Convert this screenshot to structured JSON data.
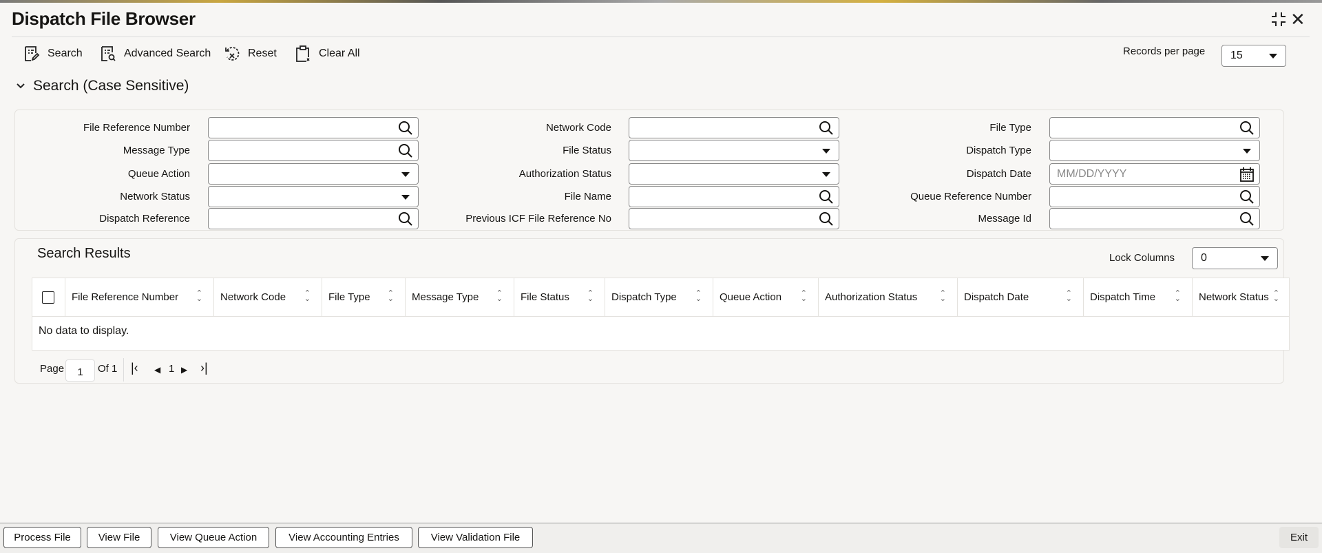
{
  "header": {
    "title": "Dispatch File Browser"
  },
  "toolbar": {
    "search": "Search",
    "advanced_search": "Advanced Search",
    "reset": "Reset",
    "clear_all": "Clear All"
  },
  "records_per_page": {
    "label": "Records per page",
    "value": "15"
  },
  "search_section": {
    "title": "Search (Case Sensitive)",
    "fields": [
      {
        "label": "File Reference Number",
        "type": "search",
        "value": ""
      },
      {
        "label": "Network Code",
        "type": "search",
        "value": ""
      },
      {
        "label": "File Type",
        "type": "search",
        "value": ""
      },
      {
        "label": "Message Type",
        "type": "search",
        "value": ""
      },
      {
        "label": "File Status",
        "type": "select",
        "value": ""
      },
      {
        "label": "Dispatch Type",
        "type": "select",
        "value": ""
      },
      {
        "label": "Queue Action",
        "type": "select",
        "value": ""
      },
      {
        "label": "Authorization Status",
        "type": "select",
        "value": ""
      },
      {
        "label": "Dispatch Date",
        "type": "date",
        "value": "",
        "placeholder": "MM/DD/YYYY"
      },
      {
        "label": "Network Status",
        "type": "select",
        "value": ""
      },
      {
        "label": "File Name",
        "type": "search",
        "value": ""
      },
      {
        "label": "Queue Reference Number",
        "type": "search",
        "value": ""
      },
      {
        "label": "Dispatch Reference",
        "type": "search",
        "value": ""
      },
      {
        "label": "Previous ICF File Reference No",
        "type": "search",
        "value": ""
      },
      {
        "label": "Message Id",
        "type": "search",
        "value": ""
      }
    ]
  },
  "results": {
    "title": "Search Results",
    "lock_columns_label": "Lock Columns",
    "lock_columns_value": "0",
    "columns": [
      "File Reference Number",
      "Network Code",
      "File Type",
      "Message Type",
      "File Status",
      "Dispatch Type",
      "Queue Action",
      "Authorization Status",
      "Dispatch Date",
      "Dispatch Time",
      "Network Status"
    ],
    "empty_text": "No data to display.",
    "pager": {
      "page_label": "Page",
      "page": "1",
      "of_label": "Of 1",
      "current": "1"
    }
  },
  "footer": {
    "buttons": [
      "Process File",
      "View File",
      "View Queue Action",
      "View Accounting Entries",
      "View Validation File"
    ],
    "exit": "Exit"
  }
}
